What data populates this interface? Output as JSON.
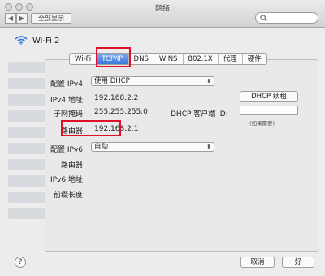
{
  "window": {
    "title": "网络",
    "show_all": "全部显示"
  },
  "network": {
    "name": "Wi-Fi 2"
  },
  "tabs": [
    "Wi-Fi",
    "TCP/IP",
    "DNS",
    "WINS",
    "802.1X",
    "代理",
    "硬件"
  ],
  "ipv4": {
    "config_label": "配置 IPv4:",
    "config_value": "使用 DHCP",
    "address_label": "IPv4 地址:",
    "address_value": "192.168.2.2",
    "subnet_label": "子网掩码:",
    "subnet_value": "255.255.255.0",
    "router_label": "路由器:",
    "router_value": "192.168.2.1",
    "renew_button": "DHCP 续租",
    "client_id_label": "DHCP 客户端 ID:",
    "client_id_hint": "(如果需要)"
  },
  "ipv6": {
    "config_label": "配置 IPv6:",
    "config_value": "自动",
    "router_label": "路由器:",
    "address_label": "IPv6 地址:",
    "prefix_label": "前缀长度:"
  },
  "footer": {
    "help": "?",
    "cancel": "取消",
    "ok": "好"
  },
  "accent_color": "#3a78d8",
  "highlight_color": "#e0102a"
}
